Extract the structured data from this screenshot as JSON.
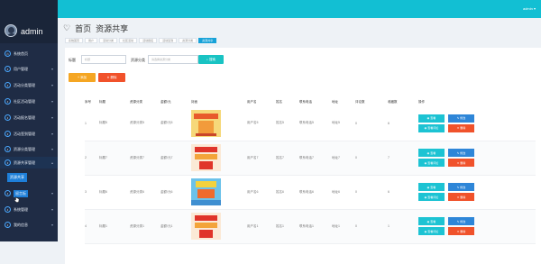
{
  "user": "admin",
  "topbar_user": "admin",
  "nav": [
    {
      "label": "系统首页",
      "icon": "home-icon"
    },
    {
      "label": "用户管理",
      "icon": "user-icon"
    },
    {
      "label": "活动分类管理",
      "icon": "category-icon"
    },
    {
      "label": "社区活动管理",
      "icon": "activity-icon"
    },
    {
      "label": "活动报名管理",
      "icon": "signup-icon"
    },
    {
      "label": "活动签到管理",
      "icon": "checkin-icon"
    },
    {
      "label": "资源分类管理",
      "icon": "resource-category-icon"
    },
    {
      "label": "资源共享管理",
      "icon": "share-icon"
    },
    {
      "label": "留言板",
      "icon": "message-icon"
    },
    {
      "label": "系统管理",
      "icon": "system-icon"
    },
    {
      "label": "我的信息",
      "icon": "profile-icon"
    }
  ],
  "sub_nav": "资源共享",
  "breadcrumb": {
    "home": "首页",
    "section": "资源共享"
  },
  "tabs": [
    "系统首页",
    "用户",
    "活动分类",
    "社区活动",
    "活动报名",
    "活动签到",
    "资源分类",
    "资源共享"
  ],
  "search": {
    "label1": "标题",
    "placeholder1": "标题",
    "label2": "资源分类",
    "placeholder2": "请选择资源分类",
    "button": "搜索"
  },
  "actions": {
    "add": "添加",
    "delete": "删除"
  },
  "table": {
    "headers": [
      "序号",
      "标题",
      "资源分类",
      "金额/元",
      "封面",
      "用户名",
      "姓名",
      "联系电话",
      "地址",
      "评论数",
      "收藏数",
      "操作"
    ],
    "rows": [
      {
        "no": "1",
        "title": "标题5",
        "category": "资源分类5",
        "amount": "金额/元5",
        "user": "用户名5",
        "name": "姓名5",
        "phone": "联系电话5",
        "addr": "地址5",
        "comments": "0",
        "favs": "6"
      },
      {
        "no": "2",
        "title": "标题7",
        "category": "资源分类7",
        "amount": "金额/元7",
        "user": "用户名7",
        "name": "姓名7",
        "phone": "联系电话7",
        "addr": "地址7",
        "comments": "0",
        "favs": "7"
      },
      {
        "no": "3",
        "title": "标题6",
        "category": "资源分类6",
        "amount": "金额/元6",
        "user": "用户名6",
        "name": "姓名6",
        "phone": "联系电话6",
        "addr": "地址6",
        "comments": "0",
        "favs": "6"
      },
      {
        "no": "4",
        "title": "标题1",
        "category": "资源分类1",
        "amount": "金额/元1",
        "user": "用户名1",
        "name": "姓名1",
        "phone": "联系电话1",
        "addr": "地址1",
        "comments": "0",
        "favs": "1"
      }
    ],
    "ops": {
      "view": "查看",
      "edit": "修改",
      "comment": "查看评论",
      "remove": "删除"
    }
  },
  "colors": {
    "topbar": "#12bfd3",
    "sidebar": "#1f2c45",
    "accent": "#1e7fd9",
    "cyan": "#1cc3d3",
    "blue": "#2e86d8",
    "red": "#f0522b",
    "orange": "#f5a623"
  }
}
